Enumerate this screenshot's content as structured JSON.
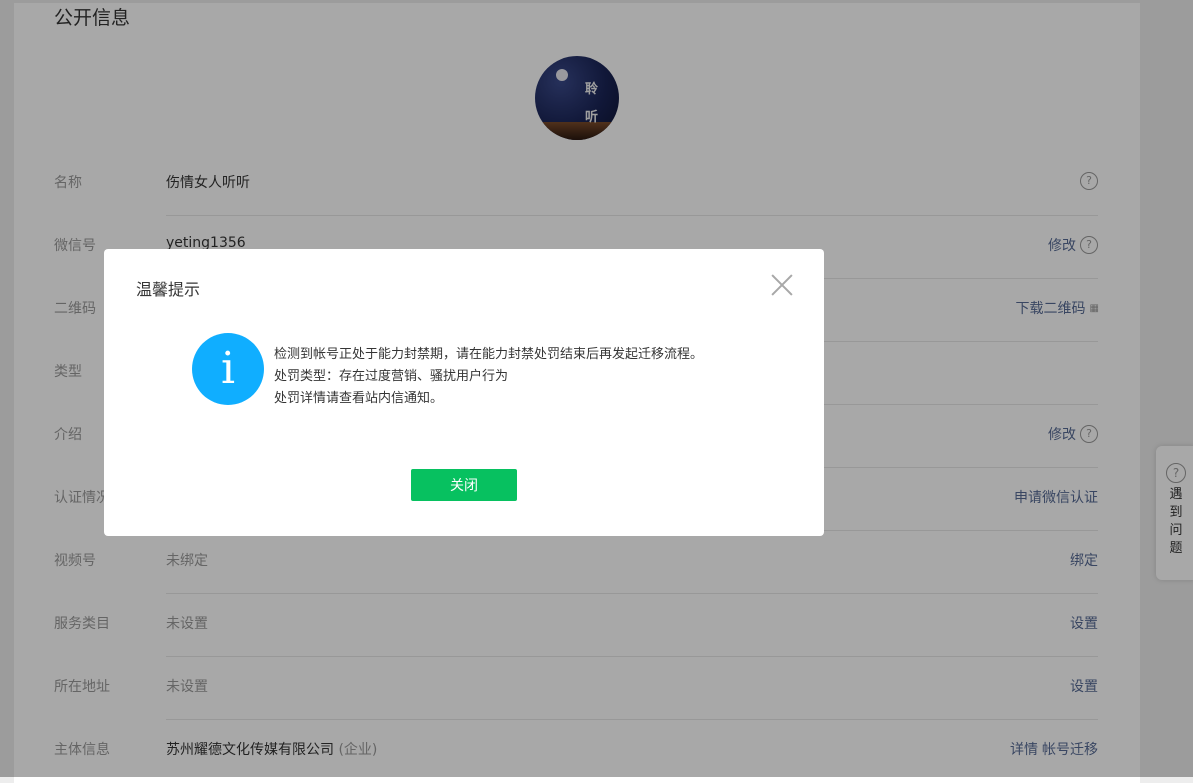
{
  "section_title": "公开信息",
  "avatar": {
    "text_line1": "聆",
    "text_line2": "听"
  },
  "rows": [
    {
      "label": "名称",
      "value": "伤情女人听听",
      "action": ""
    },
    {
      "label": "微信号",
      "value": "yeting1356",
      "action": "修改"
    },
    {
      "label": "二维码",
      "value": "",
      "action": "下载二维码"
    },
    {
      "label": "类型",
      "value": "",
      "action": ""
    },
    {
      "label": "介绍",
      "value": "",
      "action": "修改"
    },
    {
      "label": "认证情况",
      "value": "",
      "action": "申请微信认证"
    },
    {
      "label": "视频号",
      "value": "未绑定",
      "action": "绑定"
    },
    {
      "label": "服务类目",
      "value": "未设置",
      "action": "设置"
    },
    {
      "label": "所在地址",
      "value": "未设置",
      "action": "设置"
    },
    {
      "label": "主体信息",
      "value": "苏州耀德文化传媒有限公司",
      "value_suffix": "(企业)",
      "action": "详情",
      "action2": "帐号迁移"
    }
  ],
  "help_float": {
    "text": "遇\n到\n问\n题"
  },
  "dialog": {
    "title": "温馨提示",
    "message_lines": [
      "检测到帐号正处于能力封禁期，请在能力封禁处罚结束后再发起迁移流程。",
      "处罚类型：存在过度营销、骚扰用户行为",
      "处罚详情请查看站内信通知。"
    ],
    "close_button": "关闭"
  },
  "colors": {
    "primary_green": "#07c160",
    "info_blue": "#10aeff",
    "link": "#576b95"
  }
}
